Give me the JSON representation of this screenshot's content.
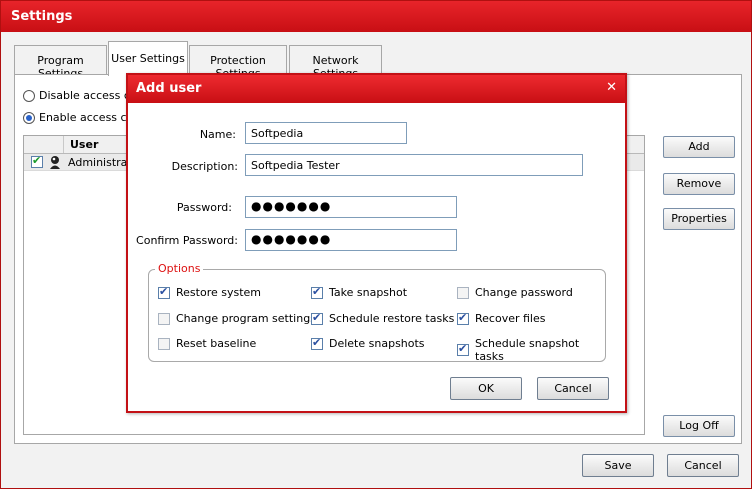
{
  "window": {
    "title": "Settings",
    "close_glyph": "✕"
  },
  "tabs": [
    {
      "label": "Program Settings"
    },
    {
      "label": "User Settings"
    },
    {
      "label": "Protection Settings"
    },
    {
      "label": "Network Settings"
    }
  ],
  "access": {
    "disable_label": "Disable access co",
    "enable_label": "Enable access co",
    "selected": "enable"
  },
  "user_table": {
    "header_user": "User",
    "rows": [
      {
        "checked": true,
        "icon": "user-icon",
        "name": "Administrat"
      }
    ]
  },
  "side_buttons": {
    "add": "Add",
    "remove": "Remove",
    "properties": "Properties",
    "log_off": "Log Off"
  },
  "bottom_buttons": {
    "save": "Save",
    "cancel": "Cancel"
  },
  "dialog": {
    "title": "Add user",
    "close_glyph": "✕",
    "name_label": "Name:",
    "name_value": "Softpedia",
    "description_label": "Description:",
    "description_value": "Softpedia Tester",
    "password_label": "Password:",
    "password_value": "●●●●●●●",
    "confirm_label": "Confirm Password:",
    "confirm_value": "●●●●●●●",
    "options_legend": "Options",
    "options": {
      "restore_system": {
        "label": "Restore system",
        "checked": true
      },
      "take_snapshot": {
        "label": "Take snapshot",
        "checked": true
      },
      "change_password": {
        "label": "Change password",
        "checked": false
      },
      "change_program_settings": {
        "label": "Change program settings",
        "checked": false
      },
      "schedule_restore_tasks": {
        "label": "Schedule restore tasks",
        "checked": true
      },
      "recover_files": {
        "label": "Recover files",
        "checked": true
      },
      "reset_baseline": {
        "label": "Reset baseline",
        "checked": false
      },
      "delete_snapshots": {
        "label": "Delete snapshots",
        "checked": true
      },
      "schedule_snapshot_tasks": {
        "label": "Schedule snapshot tasks",
        "checked": true
      }
    },
    "ok_label": "OK",
    "cancel_label": "Cancel"
  },
  "colors": {
    "title_red": "#d31a1f",
    "accent_blue": "#2a62c8",
    "border": "#a7a7a7"
  }
}
